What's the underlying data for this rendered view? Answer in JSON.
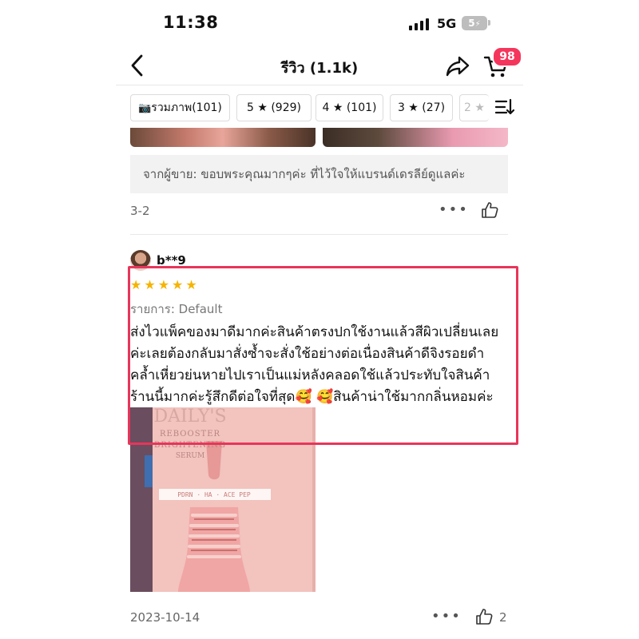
{
  "status_bar": {
    "time": "11:38",
    "network": "5G",
    "battery": "5"
  },
  "header": {
    "title": "รีวิว (1.1k)",
    "cart_count": "98"
  },
  "filters": [
    {
      "label": "รวมภาพ(101)"
    },
    {
      "label": "5 ★ (929)"
    },
    {
      "label": "4 ★ (101)"
    },
    {
      "label": "3 ★ (27)"
    },
    {
      "label": "2 ★"
    }
  ],
  "previous_review": {
    "seller_reply": "จากผู้ขาย: ขอบพระคุณมากๆค่ะ ที่ไว้ใจให้แบรนด์เดรลีย์ดูแลค่ะ",
    "date": "3-2",
    "more": "•••"
  },
  "review": {
    "username": "b**9",
    "rating": 5,
    "stars": "★★★★★",
    "variant": "รายการ: Default",
    "text_lines": [
      "ส่งไวแพ็คของมาดีมากค่ะสินค้าตรงปกใช้งานแล้วสีผิวเปลี่ยนเลย",
      "ค่ะเลยต้องกลับมาสั่งซ้ำจะสั่งใช้อย่างต่อเนื่องสินค้าดีจิงรอยดำ",
      "คล้ำเหี่ยวย่นหายไปเราเป็นแม่หลังคลอดใช้แล้วประทับใจสินค้า",
      "ร้านนี้มากค่ะรู้สึกดีต่อใจที่สุด🥰 🥰สินค้าน่าใช้มากกลิ่นหอมค่ะ"
    ],
    "photo": {
      "brand": "DAILY'S",
      "line1": "REBOOSTER",
      "line2": "BRIGHTENING",
      "line3": "SERUM",
      "ingredients": "PDRN · HA · ACE PEP"
    },
    "date": "2023-10-14",
    "more": "•••",
    "likes": "2"
  },
  "colors": {
    "accent": "#f5365c",
    "star": "#f5b400",
    "highlight": "#e8355a"
  }
}
